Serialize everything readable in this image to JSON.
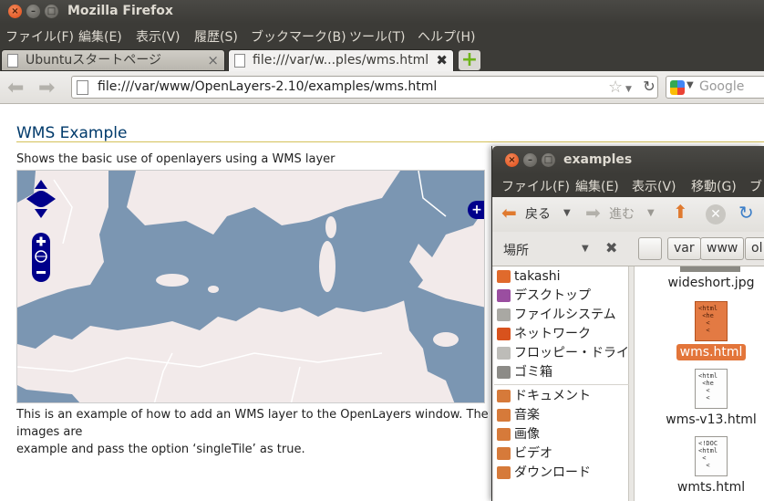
{
  "browser": {
    "title": "Mozilla Firefox",
    "menu": [
      "ファイル(F)",
      "編集(E)",
      "表示(V)",
      "履歴(S)",
      "ブックマーク(B)",
      "ツール(T)",
      "ヘルプ(H)"
    ],
    "tabs": [
      {
        "label": "Ubuntuスタートページ",
        "active": false
      },
      {
        "label": "file:///var/w...ples/wms.html",
        "active": true
      }
    ],
    "url": "file:///var/www/OpenLayers-2.10/examples/wms.html",
    "search_placeholder": "Google"
  },
  "page": {
    "title": "WMS Example",
    "shortdesc": "Shows the basic use of openlayers using a WMS layer",
    "docs": "This is an example of how to add an WMS layer to the OpenLayers window. The images are tiled in this instance. If you wish to use untiled, use the 'OpenLayers.Layer.WMS.Untiled' class in this example and pass the option ‘singleTile’ as true.",
    "docs_visible_line1": "This is an example of how to add an WMS layer to the OpenLayers window. The images are",
    "docs_visible_line2": "example and pass the option ‘singleTile’ as true.",
    "map": {
      "controls": [
        "pan-up",
        "pan-left",
        "pan-right",
        "pan-down",
        "zoom-in",
        "zoom-world",
        "zoom-out",
        "layer-switcher"
      ],
      "colors": {
        "sea": "#7b96b2",
        "land": "#f2eaea",
        "border": "#ffffff"
      }
    }
  },
  "file_manager": {
    "title": "examples",
    "menu": [
      "ファイル(F)",
      "編集(E)",
      "表示(V)",
      "移動(G)",
      "ブッ"
    ],
    "toolbar": {
      "back": "戻る",
      "forward": "進む"
    },
    "places_label": "場所",
    "breadcrumbs": [
      "var",
      "www",
      "ol"
    ],
    "sidebar": [
      {
        "label": "takashi",
        "icon": "home-icon",
        "color": "#e06a2c"
      },
      {
        "label": "デスクトップ",
        "icon": "desktop-icon",
        "color": "#9a4ea0"
      },
      {
        "label": "ファイルシステム",
        "icon": "drive-icon",
        "color": "#a9a8a3"
      },
      {
        "label": "ネットワーク",
        "icon": "network-icon",
        "color": "#d8521d"
      },
      {
        "label": "フロッピー・ドライブ",
        "icon": "floppy-icon",
        "color": "#bdbcb8"
      },
      {
        "label": "ゴミ箱",
        "icon": "trash-icon",
        "color": "#8c8b87"
      },
      {
        "label": "ドキュメント",
        "icon": "documents-folder-icon",
        "color": "#d67a3a"
      },
      {
        "label": "音楽",
        "icon": "music-folder-icon",
        "color": "#d67a3a"
      },
      {
        "label": "画像",
        "icon": "pictures-folder-icon",
        "color": "#d67a3a"
      },
      {
        "label": "ビデオ",
        "icon": "videos-folder-icon",
        "color": "#d67a3a"
      },
      {
        "label": "ダウンロード",
        "icon": "downloads-folder-icon",
        "color": "#d67a3a"
      }
    ],
    "files": [
      {
        "name": "wideshort.jpg",
        "type": "image",
        "selected": false
      },
      {
        "name": "wms.html",
        "type": "html",
        "selected": true,
        "preview": "<html\n <he\n  <\n  <"
      },
      {
        "name": "wms-v13.html",
        "type": "html",
        "selected": false,
        "preview": "<html\n <he\n  <\n  <"
      },
      {
        "name": "wmts.html",
        "type": "html",
        "selected": false,
        "preview": "<!DOC\n<html\n <\n  <"
      }
    ]
  }
}
